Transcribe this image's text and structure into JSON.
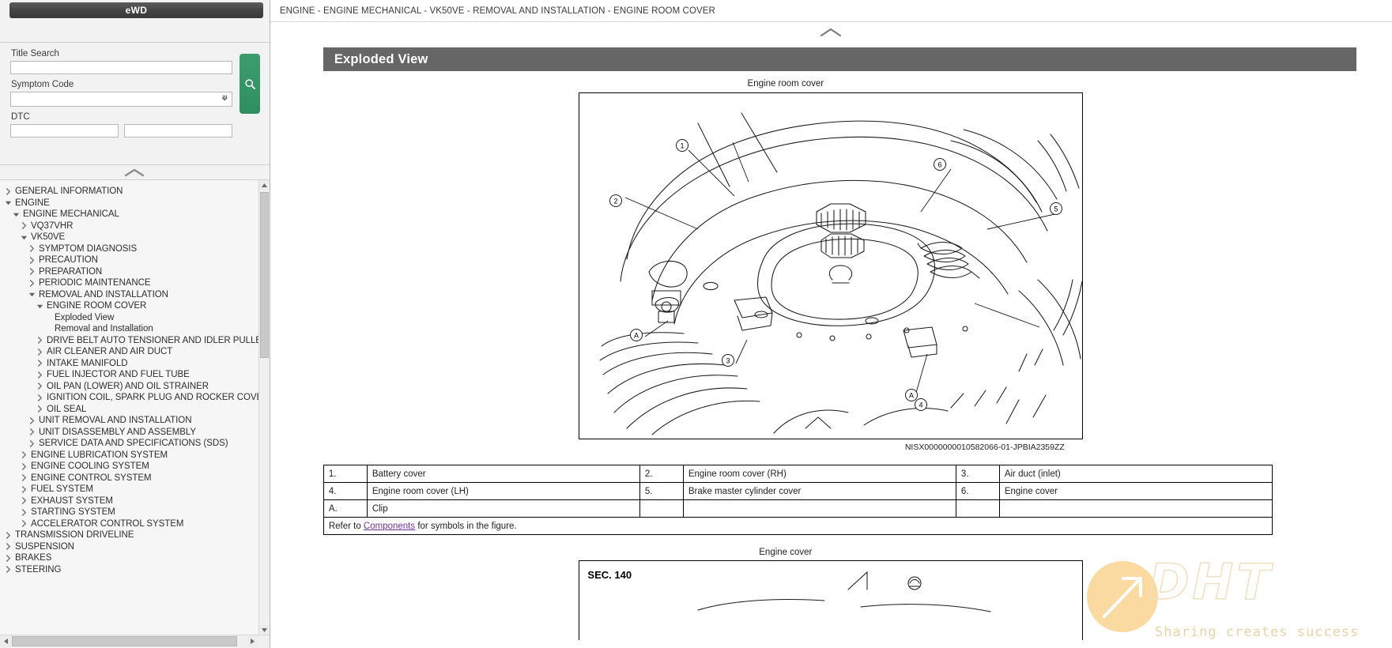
{
  "left_panel": {
    "ewd_label": "eWD",
    "search": {
      "title_search_label": "Title Search",
      "title_search_value": "",
      "title_search_placeholder": "",
      "symptom_code_label": "Symptom Code",
      "symptom_code_value": "",
      "dtc_label": "DTC",
      "dtc_value_1": "",
      "dtc_value_2": "",
      "search_icon": "search-icon",
      "collapse_icon": "chevron-up-icon",
      "accent_color": "#2f8f5f"
    },
    "tree": [
      {
        "label": "GENERAL INFORMATION",
        "indent": 0,
        "state": "collapsed"
      },
      {
        "label": "ENGINE",
        "indent": 0,
        "state": "expanded"
      },
      {
        "label": "ENGINE MECHANICAL",
        "indent": 1,
        "state": "expanded"
      },
      {
        "label": "VQ37VHR",
        "indent": 2,
        "state": "collapsed"
      },
      {
        "label": "VK50VE",
        "indent": 2,
        "state": "expanded"
      },
      {
        "label": "SYMPTOM DIAGNOSIS",
        "indent": 3,
        "state": "collapsed"
      },
      {
        "label": "PRECAUTION",
        "indent": 3,
        "state": "collapsed"
      },
      {
        "label": "PREPARATION",
        "indent": 3,
        "state": "collapsed"
      },
      {
        "label": "PERIODIC MAINTENANCE",
        "indent": 3,
        "state": "collapsed"
      },
      {
        "label": "REMOVAL AND INSTALLATION",
        "indent": 3,
        "state": "expanded"
      },
      {
        "label": "ENGINE ROOM COVER",
        "indent": 4,
        "state": "expanded"
      },
      {
        "label": "Exploded View",
        "indent": 5,
        "state": "leaf"
      },
      {
        "label": "Removal and Installation",
        "indent": 5,
        "state": "leaf"
      },
      {
        "label": "DRIVE BELT AUTO TENSIONER AND IDLER PULLE",
        "indent": 4,
        "state": "collapsed"
      },
      {
        "label": "AIR CLEANER AND AIR DUCT",
        "indent": 4,
        "state": "collapsed"
      },
      {
        "label": "INTAKE MANIFOLD",
        "indent": 4,
        "state": "collapsed"
      },
      {
        "label": "FUEL INJECTOR AND FUEL TUBE",
        "indent": 4,
        "state": "collapsed"
      },
      {
        "label": "OIL PAN (LOWER) AND OIL STRAINER",
        "indent": 4,
        "state": "collapsed"
      },
      {
        "label": "IGNITION COIL, SPARK PLUG AND ROCKER COVE",
        "indent": 4,
        "state": "collapsed"
      },
      {
        "label": "OIL SEAL",
        "indent": 4,
        "state": "collapsed"
      },
      {
        "label": "UNIT REMOVAL AND INSTALLATION",
        "indent": 3,
        "state": "collapsed"
      },
      {
        "label": "UNIT DISASSEMBLY AND ASSEMBLY",
        "indent": 3,
        "state": "collapsed"
      },
      {
        "label": "SERVICE DATA AND SPECIFICATIONS (SDS)",
        "indent": 3,
        "state": "collapsed"
      },
      {
        "label": "ENGINE LUBRICATION SYSTEM",
        "indent": 2,
        "state": "collapsed"
      },
      {
        "label": "ENGINE COOLING SYSTEM",
        "indent": 2,
        "state": "collapsed"
      },
      {
        "label": "ENGINE CONTROL SYSTEM",
        "indent": 2,
        "state": "collapsed"
      },
      {
        "label": "FUEL SYSTEM",
        "indent": 2,
        "state": "collapsed"
      },
      {
        "label": "EXHAUST SYSTEM",
        "indent": 2,
        "state": "collapsed"
      },
      {
        "label": "STARTING SYSTEM",
        "indent": 2,
        "state": "collapsed"
      },
      {
        "label": "ACCELERATOR CONTROL SYSTEM",
        "indent": 2,
        "state": "collapsed"
      },
      {
        "label": "TRANSMISSION DRIVELINE",
        "indent": 0,
        "state": "collapsed"
      },
      {
        "label": "SUSPENSION",
        "indent": 0,
        "state": "collapsed"
      },
      {
        "label": "BRAKES",
        "indent": 0,
        "state": "collapsed"
      },
      {
        "label": "STEERING",
        "indent": 0,
        "state": "collapsed"
      }
    ]
  },
  "main": {
    "breadcrumb": "ENGINE - ENGINE MECHANICAL - VK50VE - REMOVAL AND INSTALLATION - ENGINE ROOM COVER",
    "section_title": "Exploded View",
    "figure_caption": "Engine room cover",
    "figure_code": "NISX0000000010582066-01-JPBIA2359ZZ",
    "figure2_caption": "Engine cover",
    "figure2_sec": "SEC. 140",
    "callouts": [
      "1",
      "2",
      "3",
      "4",
      "5",
      "6",
      "A",
      "A"
    ],
    "parts_table": [
      [
        {
          "num": "1.",
          "name": "Battery cover"
        },
        {
          "num": "2.",
          "name": "Engine room cover (RH)"
        },
        {
          "num": "3.",
          "name": "Air duct (inlet)"
        }
      ],
      [
        {
          "num": "4.",
          "name": "Engine room cover (LH)"
        },
        {
          "num": "5.",
          "name": "Brake master cylinder cover"
        },
        {
          "num": "6.",
          "name": "Engine cover"
        }
      ],
      [
        {
          "num": "A.",
          "name": "Clip"
        },
        {
          "num": "",
          "name": ""
        },
        {
          "num": "",
          "name": ""
        }
      ]
    ],
    "note": {
      "prefix": "Refer to ",
      "link": "Components",
      "suffix": " for symbols in the figure.",
      "link_color": "#7030a0"
    }
  },
  "watermark": {
    "logo": "DHT",
    "tagline": "Sharing creates success",
    "color": "#eedfbf",
    "badge_color": "#fbd79a"
  }
}
